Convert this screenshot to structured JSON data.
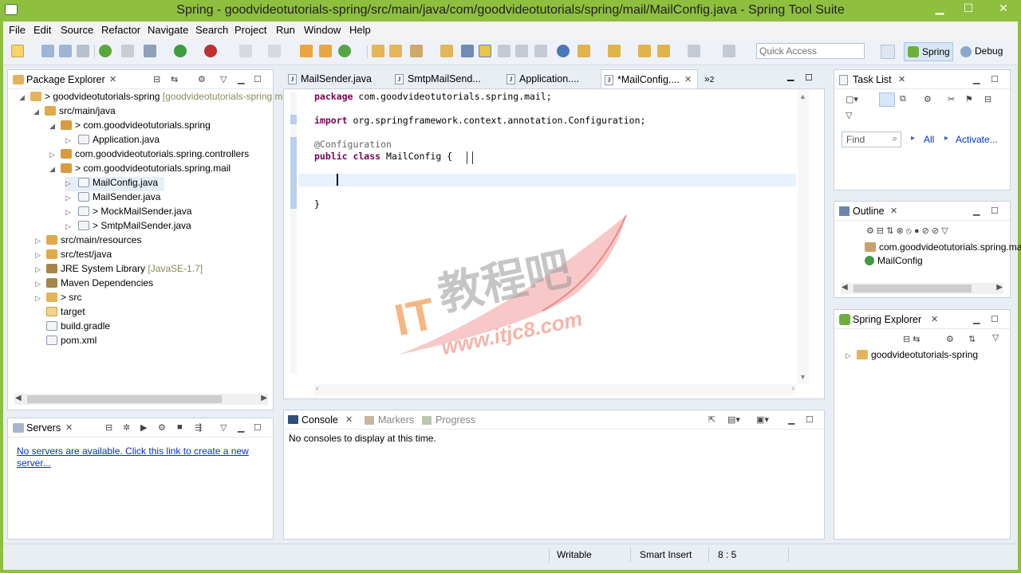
{
  "window": {
    "title": "Spring - goodvideotutorials-spring/src/main/java/com/goodvideotutorials/spring/mail/MailConfig.java - Spring Tool Suite"
  },
  "menu": [
    "File",
    "Edit",
    "Source",
    "Refactor",
    "Navigate",
    "Search",
    "Project",
    "Run",
    "Window",
    "Help"
  ],
  "toolbar": {
    "quick_access_placeholder": "Quick Access"
  },
  "perspectives": {
    "spring": "Spring",
    "debug": "Debug"
  },
  "package_explorer": {
    "title": "Package Explorer",
    "tree": [
      {
        "label": "goodvideotutorials-spring",
        "suffix": "[goodvideotutorials-spring master]"
      },
      {
        "label": "src/main/java"
      },
      {
        "label": "> com.goodvideotutorials.spring"
      },
      {
        "label": "Application.java"
      },
      {
        "label": "com.goodvideotutorials.spring.controllers"
      },
      {
        "label": "> com.goodvideotutorials.spring.mail"
      },
      {
        "label": "MailConfig.java"
      },
      {
        "label": "MailSender.java"
      },
      {
        "label": "> MockMailSender.java"
      },
      {
        "label": "> SmtpMailSender.java"
      },
      {
        "label": "src/main/resources"
      },
      {
        "label": "src/test/java"
      },
      {
        "label": "JRE System Library",
        "suffix": "[JavaSE-1.7]"
      },
      {
        "label": "Maven Dependencies"
      },
      {
        "label": "> src"
      },
      {
        "label": "target"
      },
      {
        "label": "build.gradle"
      },
      {
        "label": "pom.xml"
      }
    ]
  },
  "servers": {
    "title": "Servers",
    "link_line1": "No servers are available. Click this link to create a new",
    "link_line2": "server..."
  },
  "editor": {
    "tabs": [
      "MailSender.java",
      "SmtpMailSend...",
      "Application....",
      "*MailConfig...."
    ],
    "overflow_count": "2",
    "code": {
      "line1_kw": "package",
      "line1_rest": " com.goodvideotutorials.spring.mail;",
      "line2_kw": "import",
      "line2_rest": " org.springframework.context.annotation.Configuration;",
      "line3": "@Configuration",
      "line4_kw": "public class",
      "line4_rest": " MailConfig {",
      "line6": "}"
    }
  },
  "console": {
    "tabs": [
      "Console",
      "Markers",
      "Progress"
    ],
    "message": "No consoles to display at this time."
  },
  "task_list": {
    "title": "Task List",
    "find_placeholder": "Find",
    "all": "All",
    "activate": "Activate..."
  },
  "outline": {
    "title": "Outline",
    "items": [
      "com.goodvideotutorials.spring.mail",
      "MailConfig"
    ]
  },
  "spring_explorer": {
    "title": "Spring Explorer",
    "items": [
      "goodvideotutorials-spring"
    ]
  },
  "status": {
    "writable": "Writable",
    "insert_mode": "Smart Insert",
    "position": "8 : 5"
  },
  "watermark": {
    "chinese": "教程吧",
    "latin": "IT",
    "url": "www.itjc8.com"
  },
  "colors": {
    "window_chrome": "#8fbf3e",
    "keyword": "#7f0055",
    "link": "#0033cc"
  }
}
